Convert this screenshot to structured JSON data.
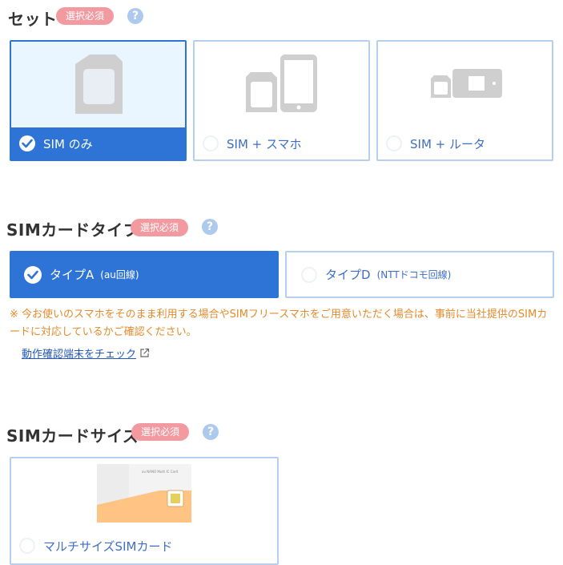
{
  "set_section": {
    "title": "セット",
    "required_badge": "選択必須",
    "help": "?",
    "options": [
      {
        "label": "SIM のみ",
        "selected": true,
        "icon": "sim-card-icon"
      },
      {
        "label": "SIM + スマホ",
        "selected": false,
        "icon": "sim-and-smartphone-icon"
      },
      {
        "label": "SIM + ルータ",
        "selected": false,
        "icon": "sim-and-router-icon"
      }
    ]
  },
  "type_section": {
    "title": "SIMカードタイプ",
    "required_badge": "選択必須",
    "help": "?",
    "options": [
      {
        "label": "タイプA",
        "sub": "(au回線)",
        "selected": true
      },
      {
        "label": "タイプD",
        "sub": "(NTTドコモ回線)",
        "selected": false
      }
    ],
    "note": "※ 今お使いのスマホをそのまま利用する場合やSIMフリースマホをご用意いただく場合は、事前に当社提供のSIMカードに対応しているかご確認ください。",
    "link": "動作確認端末をチェック"
  },
  "size_section": {
    "title": "SIMカードサイズ",
    "required_badge": "選択必須",
    "help": "?",
    "options": [
      {
        "label": "マルチサイズSIMカード",
        "selected": false,
        "card_text": "au NANO Multi IC Card"
      }
    ]
  },
  "colors": {
    "accent": "#2e74d6",
    "badge": "#f39aa0",
    "help": "#aec9ee",
    "note": "#e58a2b",
    "card_orange": "#ffc383"
  }
}
